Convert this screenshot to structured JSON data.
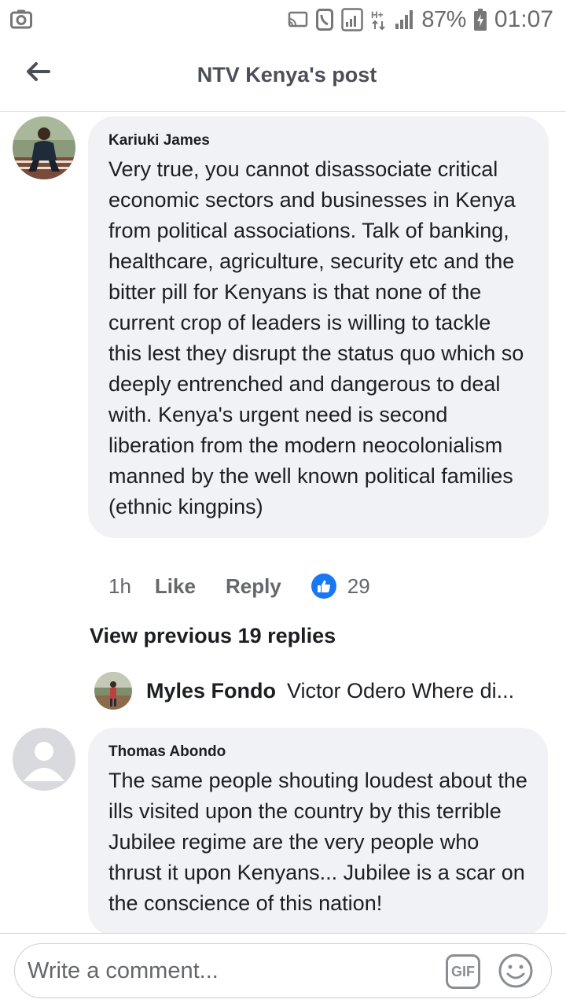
{
  "status_bar": {
    "battery": "87%",
    "time": "01:07"
  },
  "header": {
    "title": "NTV Kenya's post"
  },
  "comments": [
    {
      "author": "Kariuki James",
      "text": "Very true, you cannot disassociate critical economic sectors and businesses in Kenya from political associations. Talk of banking, healthcare, agriculture, security etc and the bitter pill for Kenyans is that none of the current crop of leaders is willing to tackle this lest they disrupt the status quo which so deeply entrenched and dangerous to deal with. Kenya's urgent need is second liberation from the modern neocolonialism manned by the well known political families (ethnic kingpins)",
      "time": "1h",
      "like_label": "Like",
      "reply_label": "Reply",
      "reaction_count": "29"
    },
    {
      "author": "Thomas Abondo",
      "text": "The same people shouting loudest about the ills visited upon the country by this terrible Jubilee regime are the very people who thrust it upon Kenyans... Jubilee is a scar on the conscience of this nation!"
    }
  ],
  "view_previous": "View previous 19 replies",
  "reply_preview": {
    "name": "Myles Fondo",
    "snippet": "Victor Odero Where di..."
  },
  "composer": {
    "placeholder": "Write a comment...",
    "gif_label": "GIF"
  }
}
